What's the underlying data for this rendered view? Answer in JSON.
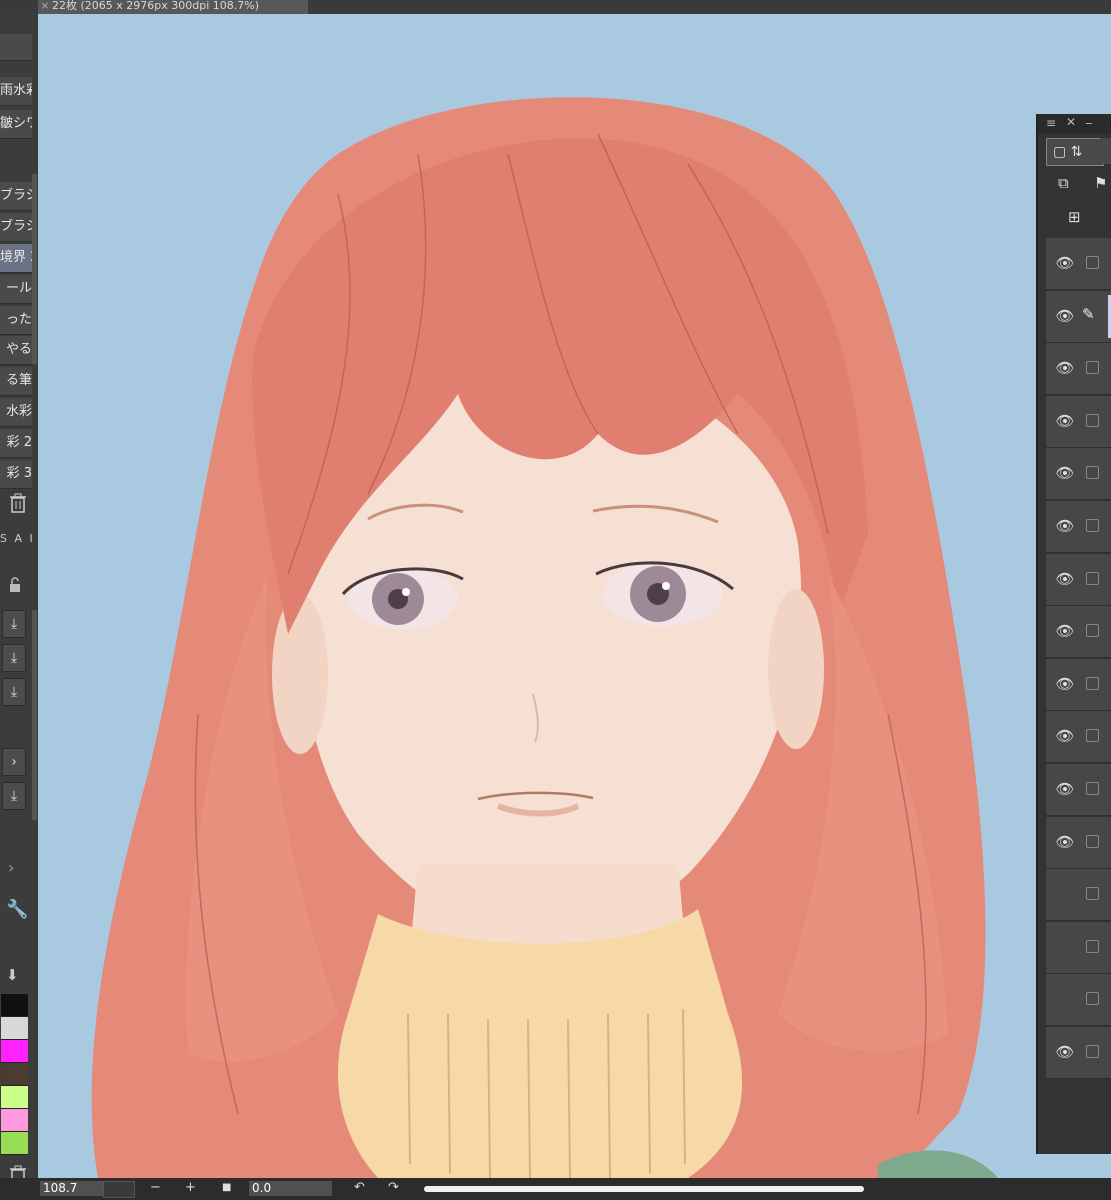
{
  "document_tab": {
    "close_glyph": "×",
    "title": "22枚 (2065 x 2976px 300dpi 108.7%)"
  },
  "brush_list": [
    {
      "label": "雨水彩"
    },
    {
      "label": "皺シワ"
    },
    {
      "label": "ブラシ"
    },
    {
      "label": "ブラシ"
    },
    {
      "label": "境界 2"
    },
    {
      "label": "ール"
    },
    {
      "label": "った"
    },
    {
      "label": "やる"
    },
    {
      "label": "る筆"
    },
    {
      "label": "水彩"
    },
    {
      "label": "彩 2"
    },
    {
      "label": "彩 3"
    }
  ],
  "blend_tabs": "S A I",
  "status": {
    "zoom": "108.7",
    "rotation": "0.0",
    "minus": "−",
    "plus": "+"
  },
  "colors": {
    "canvas_bg": "#a8c9e0",
    "hair": "#e58a79",
    "skin": "#f6e0d3",
    "sweater": "#f7d9a8",
    "swatches": [
      "#111111",
      "#d8d8d8",
      "#ff22ff",
      "#4b3b30",
      "#ccff88",
      "#ff99dd",
      "#99dd55"
    ]
  },
  "layers": [
    {
      "visible": true,
      "icon": "none"
    },
    {
      "visible": true,
      "icon": "pen"
    },
    {
      "visible": true,
      "icon": "none"
    },
    {
      "visible": true,
      "icon": "none"
    },
    {
      "visible": true,
      "icon": "none"
    },
    {
      "visible": true,
      "icon": "none"
    },
    {
      "visible": true,
      "icon": "none"
    },
    {
      "visible": true,
      "icon": "none"
    },
    {
      "visible": true,
      "icon": "none"
    },
    {
      "visible": true,
      "icon": "none"
    },
    {
      "visible": true,
      "icon": "none"
    },
    {
      "visible": true,
      "icon": "none"
    },
    {
      "visible": false,
      "icon": "none"
    },
    {
      "visible": false,
      "icon": "none"
    },
    {
      "visible": false,
      "icon": "none"
    },
    {
      "visible": true,
      "icon": "none"
    }
  ]
}
